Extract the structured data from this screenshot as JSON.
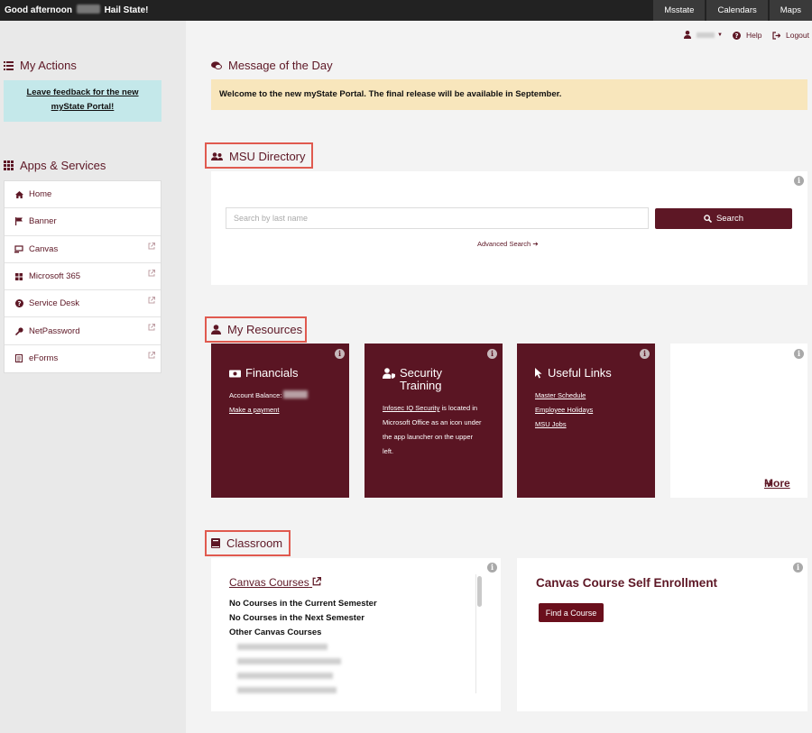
{
  "topbar": {
    "greeting_prefix": "Good afternoon",
    "greeting_suffix": "Hail State!",
    "nav": [
      "Msstate",
      "Calendars",
      "Maps"
    ]
  },
  "sidebar": {
    "my_actions_title": "My Actions",
    "feedback_line1": "Leave feedback for the new",
    "feedback_line2": "myState Portal!",
    "apps_title": "Apps & Services",
    "items": [
      {
        "label": "Home",
        "icon": "home-icon",
        "external": false
      },
      {
        "label": "Banner",
        "icon": "flag-icon",
        "external": false
      },
      {
        "label": "Canvas",
        "icon": "canvas-icon",
        "external": true
      },
      {
        "label": "Microsoft 365",
        "icon": "grid-icon",
        "external": true
      },
      {
        "label": "Service Desk",
        "icon": "question-icon",
        "external": true
      },
      {
        "label": "NetPassword",
        "icon": "key-icon",
        "external": true
      },
      {
        "label": "eForms",
        "icon": "form-icon",
        "external": true
      }
    ]
  },
  "util": {
    "help": "Help",
    "logout": "Logout"
  },
  "motd": {
    "title": "Message of the Day",
    "text": "Welcome to the new myState Portal. The final release will be available in September."
  },
  "directory": {
    "title": "MSU Directory",
    "placeholder": "Search by last name",
    "search_label": "Search",
    "advanced_label": "Advanced Search"
  },
  "resources": {
    "title": "My Resources",
    "financials": {
      "title": "Financials",
      "balance_label": "Account Balance:",
      "payment_link": "Make a payment"
    },
    "security": {
      "title_line1": "Security",
      "title_line2": "Training",
      "link": "Infosec IQ Security",
      "text1": " is located in",
      "text2": "Microsoft Office as an icon under",
      "text3": "the app launcher on the upper",
      "text4": "left."
    },
    "links": {
      "title": "Useful Links",
      "items": [
        "Master Schedule",
        "Employee Holidays",
        "MSU Jobs"
      ]
    },
    "more_label": "More"
  },
  "classroom": {
    "title": "Classroom",
    "canvas_courses_label": "Canvas Courses",
    "lines": [
      "No Courses in the Current Semester",
      "No Courses in the Next Semester",
      "Other Canvas Courses"
    ],
    "enroll_title": "Canvas Course Self Enrollment",
    "find_course_label": "Find a Course"
  },
  "colors": {
    "maroon": "#5d1725",
    "highlight_box": "#e05a4f",
    "motd_bg": "#f8e6bc",
    "feedback_bg": "#c4e8ea"
  }
}
